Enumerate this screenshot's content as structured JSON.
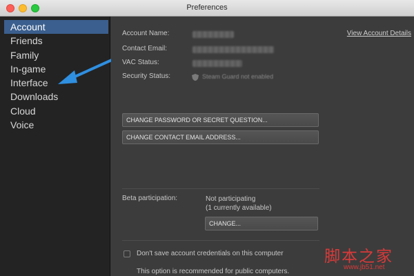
{
  "window": {
    "title": "Preferences"
  },
  "sidebar": {
    "items": [
      {
        "label": "Account",
        "active": true
      },
      {
        "label": "Friends"
      },
      {
        "label": "Family"
      },
      {
        "label": "In-game"
      },
      {
        "label": "Interface"
      },
      {
        "label": "Downloads"
      },
      {
        "label": "Cloud"
      },
      {
        "label": "Voice"
      }
    ]
  },
  "account": {
    "fields": {
      "name_label": "Account Name:",
      "email_label": "Contact Email:",
      "vac_label": "VAC Status:",
      "security_label": "Security Status:",
      "security_value": "Steam Guard not enabled"
    },
    "view_details_link": "View Account Details",
    "change_password_button": "CHANGE PASSWORD OR SECRET QUESTION...",
    "change_email_button": "CHANGE CONTACT EMAIL ADDRESS..."
  },
  "beta": {
    "label": "Beta participation:",
    "status": "Not participating",
    "available": "(1 currently available)",
    "change_button": "CHANGE..."
  },
  "credentials": {
    "checkbox_label": "Don't save account credentials on this computer",
    "checked": false,
    "note": "This option is recommended for public computers."
  },
  "annotation": {
    "arrow_color": "#2f8fe0"
  },
  "watermark": {
    "main": "脚本之家",
    "sub": "www.jb51.net"
  },
  "colors": {
    "active_nav": "#3b5f8e",
    "sidebar_bg": "#232323",
    "content_bg": "#3c3c3c"
  }
}
